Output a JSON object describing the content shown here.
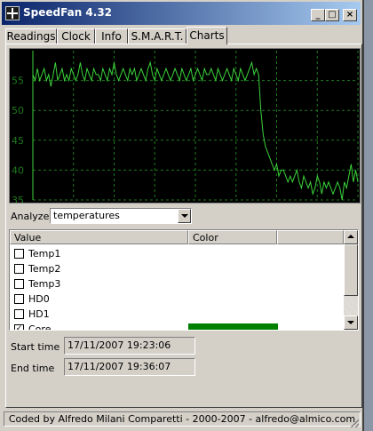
{
  "window": {
    "title": "SpeedFan 4.32",
    "minimize_label": "_",
    "maximize_label": "□",
    "close_label": "×"
  },
  "tabs": [
    {
      "label": "Readings"
    },
    {
      "label": "Clock"
    },
    {
      "label": "Info"
    },
    {
      "label": "S.M.A.R.T."
    },
    {
      "label": "Charts",
      "active": true
    }
  ],
  "chart_data": {
    "type": "line",
    "ylim": [
      35,
      60
    ],
    "yticks": [
      "55",
      "50",
      "45",
      "40",
      "35"
    ],
    "grid": true,
    "background": "#000000",
    "grid_color": "#1f7a1f",
    "line_color": "#3bd23b",
    "series": [
      {
        "values": [
          56,
          55,
          57,
          55,
          56,
          57,
          55,
          56,
          54,
          56,
          58,
          55,
          56,
          57,
          55,
          56,
          55,
          57,
          56,
          55,
          56,
          58,
          56,
          55,
          57,
          56,
          55,
          57,
          56,
          56,
          55,
          57,
          56,
          55,
          57,
          56,
          58,
          56,
          55,
          56,
          57,
          56,
          55,
          57,
          56,
          57,
          55,
          56,
          57,
          56,
          55,
          57,
          58,
          56,
          55,
          57,
          56,
          55,
          56,
          57,
          56,
          55,
          56,
          57,
          56,
          55,
          57,
          56,
          55,
          56,
          57,
          55,
          56,
          57,
          56,
          55,
          57,
          56,
          56,
          57,
          56,
          55,
          57,
          56,
          55,
          56,
          57,
          56,
          55,
          57,
          56,
          55,
          57,
          56,
          55,
          56,
          57,
          58,
          56,
          57,
          56,
          50,
          46,
          44,
          43,
          42,
          41,
          40,
          41,
          39,
          40,
          40,
          39,
          38,
          39,
          38,
          39,
          40,
          38,
          37,
          39,
          38,
          37,
          38,
          36,
          37,
          39,
          38,
          36,
          38,
          37,
          38,
          37,
          36,
          37,
          38,
          37,
          35,
          38,
          37,
          39,
          41,
          38,
          40,
          38
        ]
      }
    ]
  },
  "analyze": {
    "label": "Analyze",
    "value": "temperatures"
  },
  "list": {
    "columns": [
      "Value",
      "Color"
    ],
    "rows": [
      {
        "label": "Temp1",
        "checked": false,
        "check_mark": "",
        "color": ""
      },
      {
        "label": "Temp2",
        "checked": false,
        "check_mark": "",
        "color": ""
      },
      {
        "label": "Temp3",
        "checked": false,
        "check_mark": "",
        "color": ""
      },
      {
        "label": "HD0",
        "checked": false,
        "check_mark": "",
        "color": ""
      },
      {
        "label": "HD1",
        "checked": false,
        "check_mark": "",
        "color": ""
      },
      {
        "label": "Core",
        "checked": true,
        "check_mark": "✓",
        "color": "#008000"
      }
    ]
  },
  "start_time": {
    "label": "Start time",
    "value": "17/11/2007 19:23:06"
  },
  "end_time": {
    "label": "End time",
    "value": "17/11/2007 19:36:07"
  },
  "status": {
    "text": "Coded by Alfredo Milani Comparetti - 2000-2007 - alfredo@almico.com"
  }
}
